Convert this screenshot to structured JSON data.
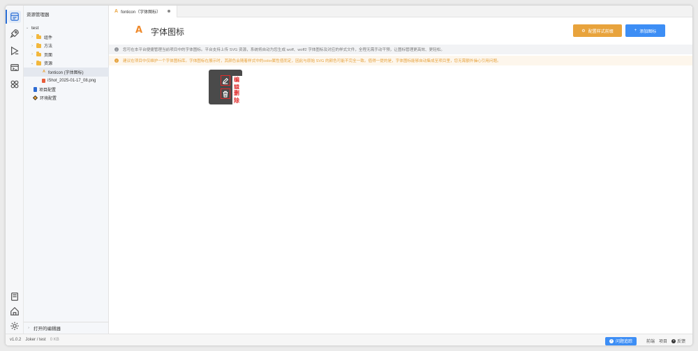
{
  "explorer": {
    "title": "资源管理器",
    "root": "test",
    "items": [
      {
        "label": "组件"
      },
      {
        "label": "方法"
      },
      {
        "label": "页面"
      },
      {
        "label": "资源"
      },
      {
        "label": "fonticon (字体图标)"
      },
      {
        "label": "iShot_2025-01-17_08.png"
      },
      {
        "label": "项目配置"
      },
      {
        "label": "环境配置"
      }
    ],
    "open_editors": "打开的编辑器"
  },
  "tab": {
    "label": "fonticon（字体图标）"
  },
  "header": {
    "title": "字体图标",
    "btn_config": "配置样式前缀",
    "btn_add": "添加图标"
  },
  "notices": {
    "info": "您可在本平台便捷管理当前项目中的字体图标。平台支持上传 SVG 资源，系统将自动为您生成 woff、woff2 字体图标及对应的样式文件，全程无需手动干预，让图标管理更高效、更轻松。",
    "warn": "建议在项目中仅维护一个字体图标库。字体图标在展示时，其颜色会随着样式中的color属性值而定，因此与原始 SVG 的颜色可能不完全一致。值得一提的是，字体图标能够自动集成至项目里，您无需额外操心引用问题。"
  },
  "icon_card": {
    "edit_label": "编辑",
    "delete_label": "删除"
  },
  "statusbar": {
    "version": "v1.0.2",
    "path": "Joker / test",
    "size": "0 KB",
    "feedback_btn": "问题追踪",
    "link_frontend": "前端",
    "link_project": "项目",
    "link_feedback": "反馈"
  },
  "colors": {
    "accent": "#2b6fd6",
    "orange": "#e8a33c",
    "blue": "#3d8ef5",
    "danger": "#e02c2c"
  }
}
